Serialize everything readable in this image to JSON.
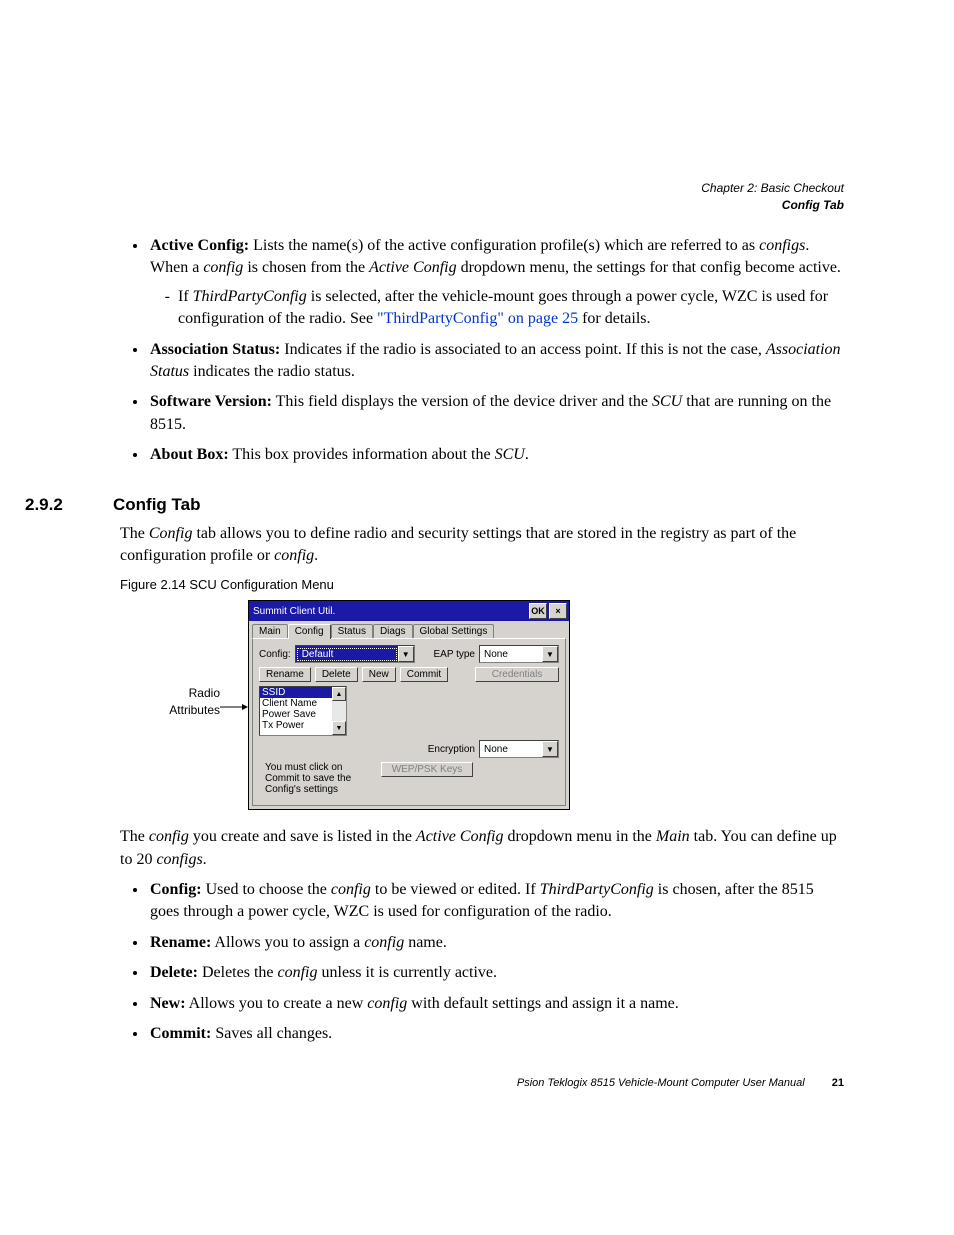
{
  "header": {
    "line1": "Chapter 2: Basic Checkout",
    "line2": "Config Tab"
  },
  "bullets_top": {
    "active_config": {
      "label": "Active Config:",
      "text_a": " Lists the name(s) of the active configuration profile(s) which are referred to as ",
      "italic1": "configs",
      "text_b": ". When a ",
      "italic2": "config",
      "text_c": " is chosen from the ",
      "italic3": "Active Config",
      "text_d": " dropdown menu, the settings for that config become active.",
      "sub": {
        "text_a": "If ",
        "italic1": "ThirdPartyConfig",
        "text_b": " is selected, after the vehicle-mount goes through a power cycle, WZC is used for configuration of the radio. See ",
        "link": "\"ThirdPartyConfig\" on page 25",
        "text_c": " for details."
      }
    },
    "assoc_status": {
      "label": "Association Status:",
      "text_a": " Indicates if the radio is associated to an access point. If this is not the case, ",
      "italic1": "Association Status",
      "text_b": " indicates the radio status."
    },
    "software_version": {
      "label": "Software Version:",
      "text_a": " This field displays the version of the device driver and the ",
      "italic1": "SCU",
      "text_b": " that are running on the 8515."
    },
    "about_box": {
      "label": "About Box:",
      "text_a": " This box provides information about the ",
      "italic1": "SCU",
      "text_b": "."
    }
  },
  "section": {
    "number": "2.9.2",
    "title": "Config Tab"
  },
  "para1": {
    "a": "The ",
    "i1": "Config",
    "b": " tab allows you to define radio and security settings that are stored in the registry as part of the configuration profile or ",
    "i2": "config",
    "c": "."
  },
  "figure_caption": "Figure 2.14 SCU Configuration Menu",
  "annotation": {
    "line1": "Radio",
    "line2": "Attributes"
  },
  "app": {
    "title": "Summit Client Util.",
    "ok": "OK",
    "close": "×",
    "tabs": [
      "Main",
      "Config",
      "Status",
      "Diags",
      "Global Settings"
    ],
    "config_label": "Config:",
    "config_value": "Default",
    "eap_label": "EAP type",
    "eap_value": "None",
    "btn_rename": "Rename",
    "btn_delete": "Delete",
    "btn_new": "New",
    "btn_commit": "Commit",
    "btn_credentials": "Credentials",
    "list_items": [
      "SSID",
      "Client Name",
      "Power Save",
      "Tx Power"
    ],
    "encryption_label": "Encryption",
    "encryption_value": "None",
    "btn_wep": "WEP/PSK Keys",
    "hint": "You must click on Commit to save the Config's settings"
  },
  "para2": {
    "a": "The ",
    "i1": "config",
    "b": " you create and save is listed in the ",
    "i2": "Active Config",
    "c": " dropdown menu in the ",
    "i3": "Main",
    "d": " tab. You can define up to 20 ",
    "i4": "configs",
    "e": "."
  },
  "bullets_bottom": {
    "config": {
      "label": "Config:",
      "a": " Used to choose the ",
      "i1": "config",
      "b": " to be viewed or edited. If ",
      "i2": "ThirdPartyConfig",
      "c": " is chosen, after the 8515 goes through a power cycle, WZC is used for configuration of the radio."
    },
    "rename": {
      "label": "Rename:",
      "a": " Allows you to assign a ",
      "i1": "config",
      "b": " name."
    },
    "delete": {
      "label": "Delete:",
      "a": " Deletes the ",
      "i1": "config",
      "b": " unless it is currently active."
    },
    "new": {
      "label": "New:",
      "a": " Allows you to create a new ",
      "i1": "config",
      "b": " with default settings and assign it a name."
    },
    "commit": {
      "label": "Commit:",
      "a": " Saves all changes."
    }
  },
  "footer": {
    "text": "Psion Teklogix 8515 Vehicle-Mount Computer User Manual",
    "page": "21"
  }
}
